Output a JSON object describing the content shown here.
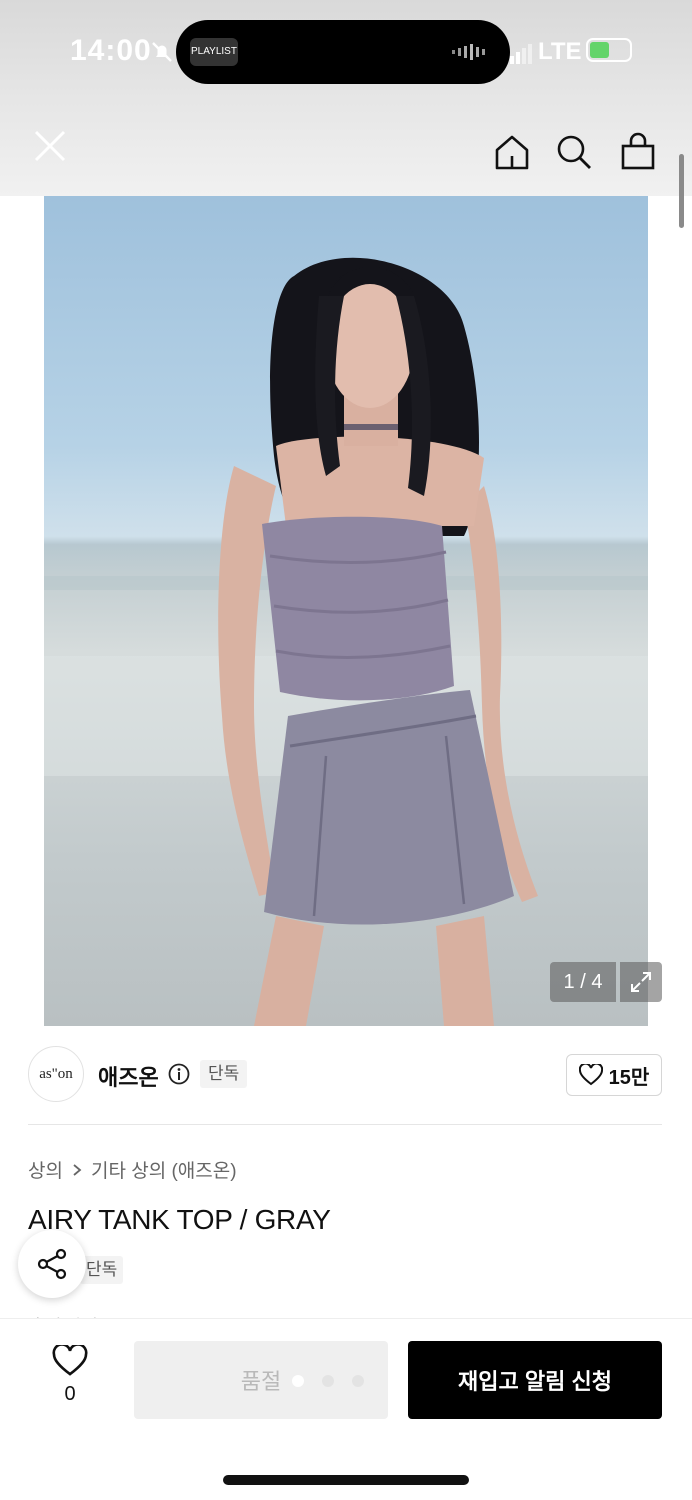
{
  "status": {
    "time": "14:00",
    "island_app": "PLAYLIST",
    "network": "LTE",
    "battery_level": 0.5
  },
  "header": {
    "close_icon": "close-icon",
    "home_icon": "home-icon",
    "search_icon": "search-icon",
    "bag_icon": "shopping-bag-icon"
  },
  "gallery": {
    "counter": "1 / 4",
    "expand_icon": "expand-icon"
  },
  "brand": {
    "logo_text": "as\"on",
    "name": "애즈온",
    "badge": "단독",
    "likes": "15만"
  },
  "product": {
    "breadcrumb": [
      "상의",
      "기타 상의 (애즈온)"
    ],
    "title": "AIRY TANK TOP / GRAY",
    "badge": "단독",
    "cutoff_text": "후기 상세"
  },
  "bottom": {
    "wish_count": "0",
    "soldout_label": "품절",
    "restock_label": "재입고 알림 신청"
  },
  "colors": {
    "accent": "#000000",
    "disabled_bg": "#efefef",
    "disabled_text": "#b9b9b9",
    "battery": "#64d46a"
  }
}
